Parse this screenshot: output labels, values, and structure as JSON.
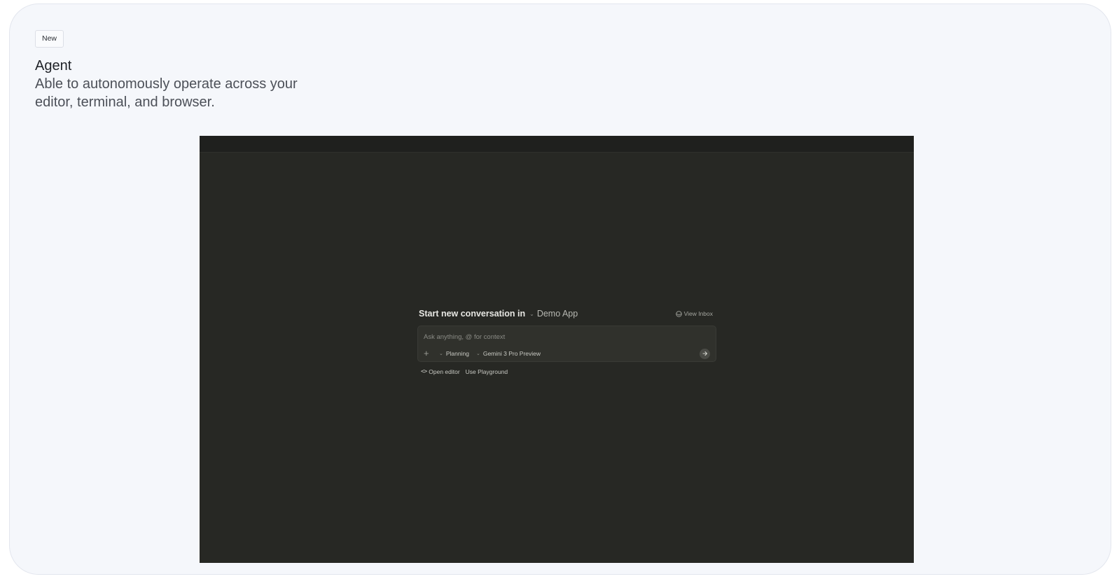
{
  "feature": {
    "badge": "New",
    "title": "Agent",
    "description": "Able to autonomously operate across your editor, terminal, and browser."
  },
  "app": {
    "conversation": {
      "prompt_label": "Start new conversation in",
      "workspace": "Demo App",
      "view_inbox": "View Inbox"
    },
    "composer": {
      "placeholder": "Ask anything, @ for context",
      "value": "",
      "mode": "Planning",
      "model": "Gemini 3 Pro Preview"
    },
    "actions": {
      "open_editor": "Open editor",
      "use_playground": "Use Playground"
    }
  },
  "colors": {
    "page_background": "#f5f7fb",
    "app_background": "#272824",
    "composer_background": "#30312c"
  },
  "icons": {
    "workspace_dropdown": "chevron-down-icon",
    "inbox": "inbox-icon",
    "add": "plus-icon",
    "send": "arrow-right-icon",
    "open_editor": "code-brackets-icon"
  }
}
